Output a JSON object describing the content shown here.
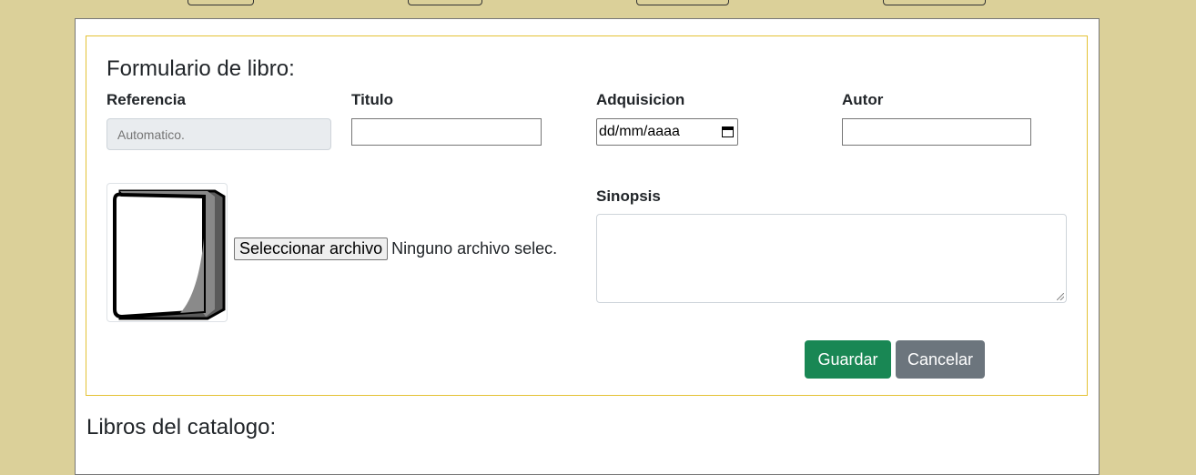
{
  "colors": {
    "page_bg": "#dbd099",
    "form_border": "#e4c235",
    "save_button": "#198754",
    "cancel_button": "#6c757d"
  },
  "form": {
    "title": "Formulario de libro:",
    "labels": {
      "referencia": "Referencia",
      "titulo": "Titulo",
      "adquisicion": "Adquisicion",
      "autor": "Autor",
      "sinopsis": "Sinopsis"
    },
    "fields": {
      "referencia_placeholder": "Automatico.",
      "titulo_value": "",
      "adquisicion_placeholder": "dd/mm/aaaa",
      "autor_value": "",
      "sinopsis_value": ""
    },
    "file_input": {
      "button_label": "Seleccionar archivo",
      "status": "Ninguno archivo selec."
    },
    "image_icon": "book-icon",
    "buttons": {
      "save": "Guardar",
      "cancel": "Cancelar"
    }
  },
  "catalog": {
    "title": "Libros del catalogo:"
  }
}
